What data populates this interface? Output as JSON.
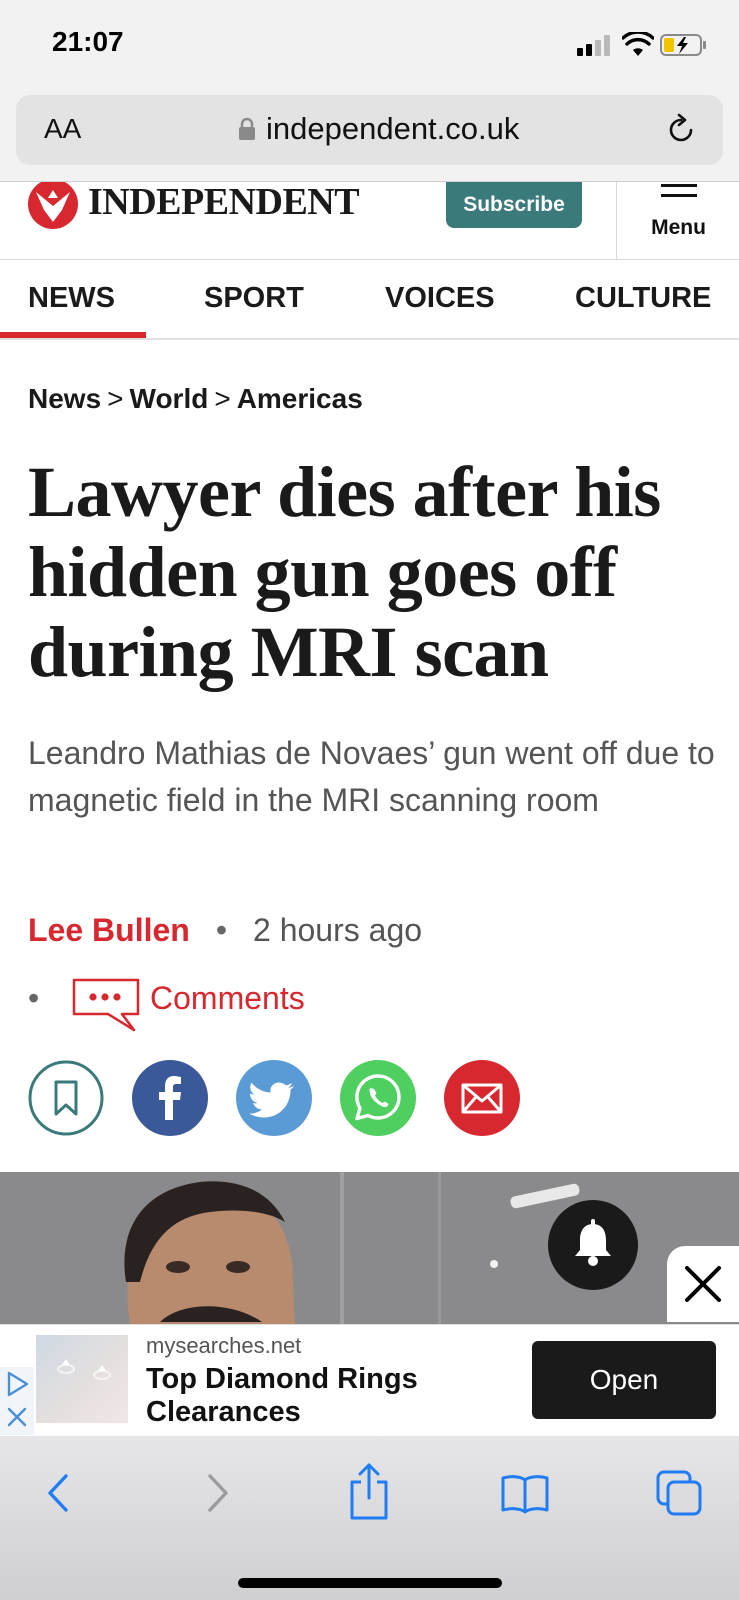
{
  "status_bar": {
    "time": "21:07"
  },
  "browser": {
    "text_size_label": "AA",
    "url": "independent.co.uk"
  },
  "site": {
    "logo_text": "INDEPENDENT",
    "subscribe_label": "Subscribe",
    "menu_label": "Menu"
  },
  "nav": {
    "tabs": [
      {
        "label": "NEWS",
        "active": true
      },
      {
        "label": "SPORT",
        "active": false
      },
      {
        "label": "VOICES",
        "active": false
      },
      {
        "label": "CULTURE",
        "active": false
      }
    ]
  },
  "article": {
    "breadcrumb": [
      "News",
      "World",
      "Americas"
    ],
    "breadcrumb_separator": ">",
    "headline": "Lawyer dies after his hidden gun goes off during MRI scan",
    "standfirst": "Leandro Mathias de Novaes’ gun went off due to magnetic field in the MRI scanning room",
    "author": "Lee Bullen",
    "time_ago": "2 hours ago",
    "separator": "•",
    "comments_label": "Comments"
  },
  "share": {
    "buttons": [
      "bookmark-icon",
      "facebook-icon",
      "twitter-icon",
      "whatsapp-icon",
      "email-icon"
    ]
  },
  "ad": {
    "source": "mysearches.net",
    "title": "Top Diamond Rings Clearances",
    "cta": "Open"
  },
  "colors": {
    "brand_red": "#d7282f",
    "subscribe_teal": "#3b7a7a",
    "facebook": "#3b5998",
    "twitter": "#5b9bd5",
    "whatsapp": "#4fcf5f",
    "email": "#d7282f",
    "ios_blue": "#1f7cf2"
  }
}
